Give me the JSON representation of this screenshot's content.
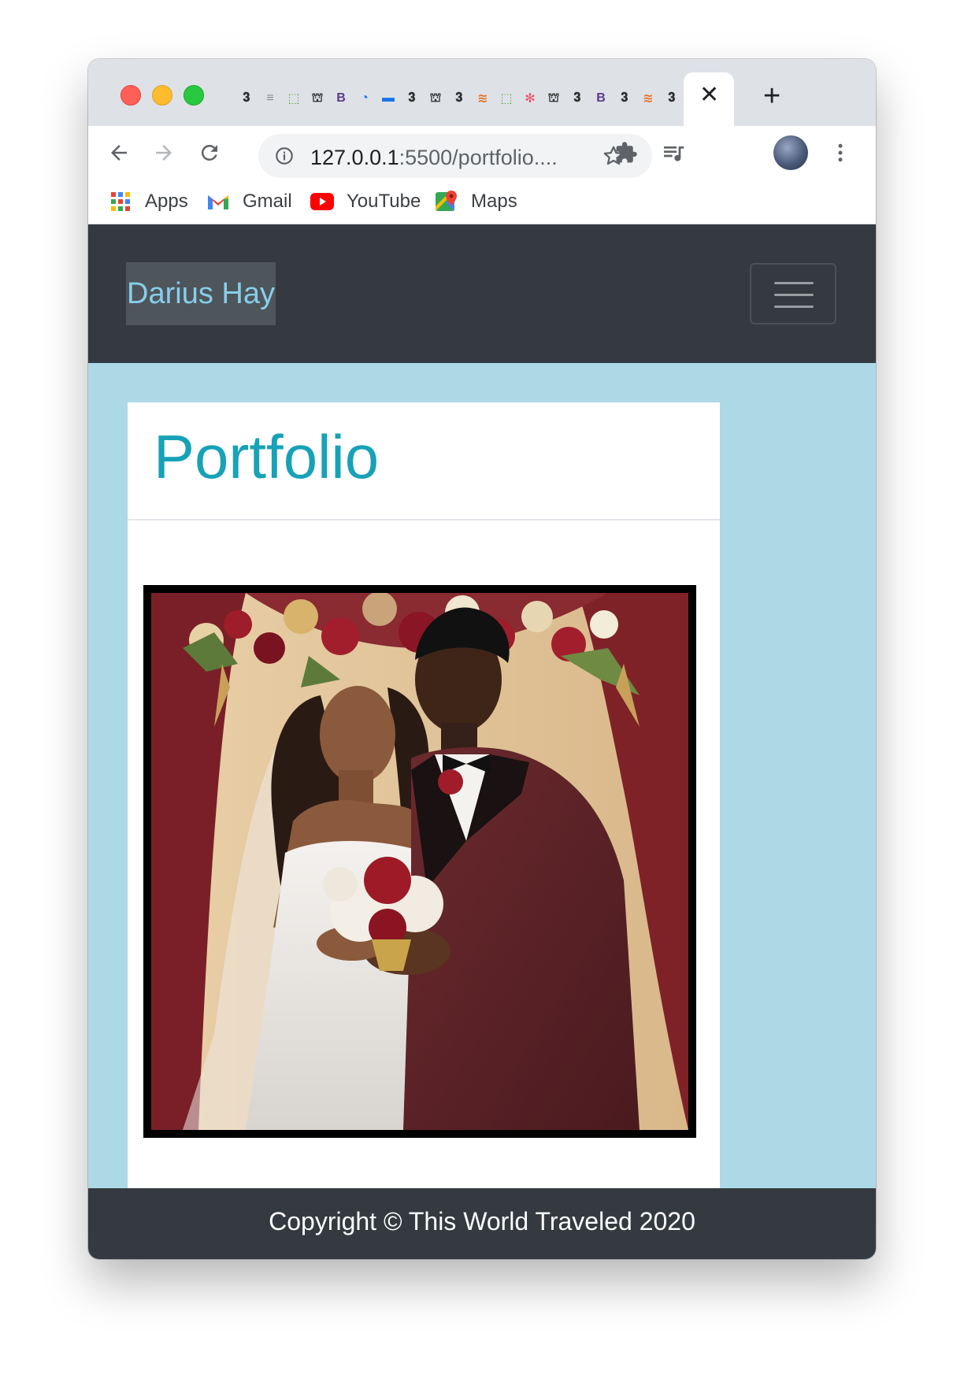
{
  "browser": {
    "pinned_tabs": [
      "𝟑",
      "≡",
      "⬚",
      "⛫",
      "B",
      "◔",
      "▬",
      "𝟑",
      "⛫",
      "𝟑",
      "≋",
      "⬚",
      "✻",
      "⛫",
      "𝟑",
      "B",
      "𝟑",
      "≋",
      "𝟑"
    ],
    "close_glyph": "✕",
    "new_tab_glyph": "+",
    "url_host": "127.0.0.1",
    "url_path": ":5500/portfolio....",
    "bookmarks": [
      {
        "label": "Apps",
        "icon": "apps-grid-icon"
      },
      {
        "label": "Gmail",
        "icon": "gmail-icon"
      },
      {
        "label": "YouTube",
        "icon": "youtube-icon"
      },
      {
        "label": "Maps",
        "icon": "maps-icon"
      }
    ]
  },
  "navbar": {
    "brand": "Darius Hay"
  },
  "main": {
    "title": "Portfolio",
    "photo_alt": "wedding-photo"
  },
  "footer": {
    "text": "Copyright © This World Traveled 2020"
  },
  "colors": {
    "navbar_bg": "#343a40",
    "page_bg": "#add8e6",
    "title": "#17a2b8",
    "brand_text": "#87ceeb"
  }
}
